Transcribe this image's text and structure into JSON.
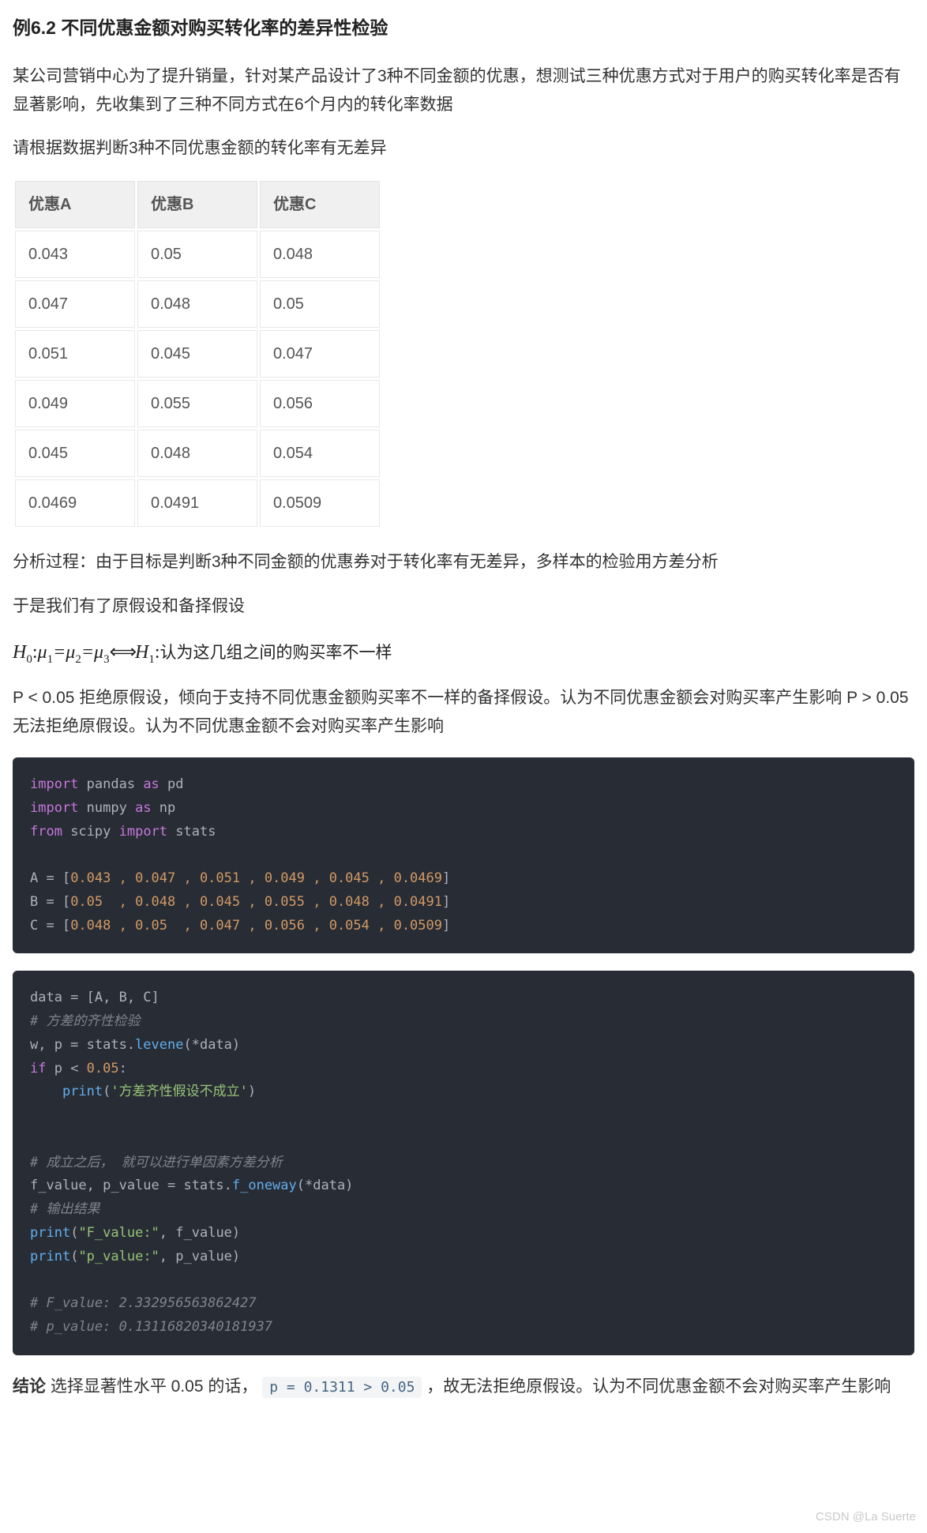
{
  "heading": "例6.2 不同优惠金额对购买转化率的差异性检验",
  "para1": "某公司营销中心为了提升销量，针对某产品设计了3种不同金额的优惠，想测试三种优惠方式对于用户的购买转化率是否有显著影响，先收集到了三种不同方式在6个月内的转化率数据",
  "para2": "请根据数据判断3种不同优惠金额的转化率有无差异",
  "table": {
    "headers": [
      "优惠A",
      "优惠B",
      "优惠C"
    ],
    "rows": [
      [
        "0.043",
        "0.05",
        "0.048"
      ],
      [
        "0.047",
        "0.048",
        "0.05"
      ],
      [
        "0.051",
        "0.045",
        "0.047"
      ],
      [
        "0.049",
        "0.055",
        "0.056"
      ],
      [
        "0.045",
        "0.048",
        "0.054"
      ],
      [
        "0.0469",
        "0.0491",
        "0.0509"
      ]
    ]
  },
  "para3": "分析过程：由于目标是判断3种不同金额的优惠券对于转化率有无差异，多样本的检验用方差分析",
  "para4": "于是我们有了原假设和备择假设",
  "hypothesis": {
    "H0_label": "H",
    "H0_sub": "0",
    "mu": "μ",
    "eq": "=",
    "sub1": "1",
    "sub2": "2",
    "sub3": "3",
    "arrow": "⟺",
    "H1_label": "H",
    "H1_sub": "1",
    "colon": ":",
    "trail": "认为这几组之间的购买率不一样"
  },
  "para5": "P < 0.05 拒绝原假设，倾向于支持不同优惠金额购买率不一样的备择假设。认为不同优惠金额会对购买率产生影响 P > 0.05 无法拒绝原假设。认为不同优惠金额不会对购买率产生影响",
  "code1": {
    "l1_import": "import",
    "l1_mod": " pandas ",
    "l1_as": "as",
    "l1_alias": " pd",
    "l2_import": "import",
    "l2_mod": " numpy ",
    "l2_as": "as",
    "l2_alias": " np",
    "l3_from": "from",
    "l3_mod": " scipy ",
    "l3_import": "import",
    "l3_item": " stats",
    "l5a": "A = [",
    "l5n": "0.043 , 0.047 , 0.051 , 0.049 , 0.045 , 0.0469",
    "l5b": "]",
    "l6a": "B = [",
    "l6n": "0.05  , 0.048 , 0.045 , 0.055 , 0.048 , 0.0491",
    "l6b": "]",
    "l7a": "C = [",
    "l7n": "0.048 , 0.05  , 0.047 , 0.056 , 0.054 , 0.0509",
    "l7b": "]"
  },
  "code2": {
    "l1": "data = [A, B, C]",
    "l2_cmt": "# 方差的齐性检验",
    "l3a": "w, p = stats.",
    "l3fn": "levene",
    "l3b": "(*data)",
    "l4_if": "if",
    "l4_cond": " p < ",
    "l4_num": "0.05",
    "l4_colon": ":",
    "l5_indent": "    ",
    "l5_fn": "print",
    "l5_open": "(",
    "l5_str": "'方差齐性假设不成立'",
    "l5_close": ")",
    "l8_cmt": "# 成立之后， 就可以进行单因素方差分析",
    "l9a": "f_value, p_value = stats.",
    "l9fn": "f_oneway",
    "l9b": "(*data)",
    "l10_cmt": "# 输出结果",
    "l11_fn": "print",
    "l11_open": "(",
    "l11_str": "\"F_value:\"",
    "l11_rest": ", f_value)",
    "l12_fn": "print",
    "l12_open": "(",
    "l12_str": "\"p_value:\"",
    "l12_rest": ", p_value)",
    "l14_cmt": "# F_value: 2.332956563862427",
    "l15_cmt": "# p_value: 0.13116820340181937"
  },
  "conclusion": {
    "bold": "结论",
    "before": " 选择显著性水平 0.05 的话， ",
    "inline_code": "p = 0.1311 > 0.05",
    "after": " ，故无法拒绝原假设。认为不同优惠金额不会对购买率产生影响"
  },
  "watermark": "CSDN @La Suerte"
}
